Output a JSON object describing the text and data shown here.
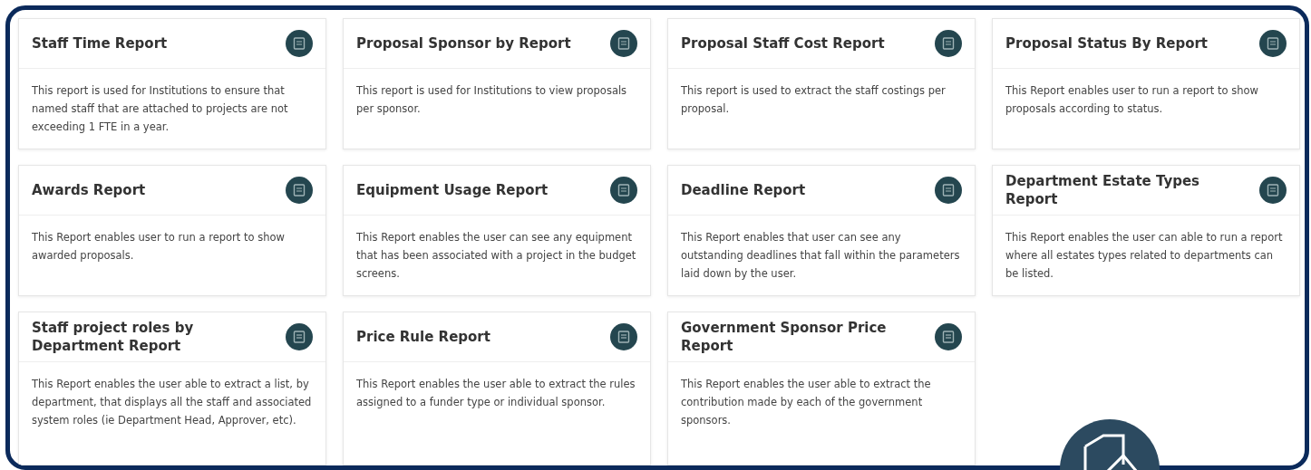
{
  "reports": [
    {
      "title": "Staff Time Report",
      "description": "This report is used for Institutions to ensure that named staff that are attached to projects are not exceeding 1 FTE in a year."
    },
    {
      "title": "Proposal Sponsor by Report",
      "description": "This report is used for Institutions to view proposals per sponsor."
    },
    {
      "title": "Proposal Staff Cost Report",
      "description": "This report is used to extract the staff costings per proposal."
    },
    {
      "title": "Proposal Status By Report",
      "description": "This Report enables user to run a report to show proposals according to status."
    },
    {
      "title": "Awards Report",
      "description": "This Report enables user to run a report to show awarded proposals."
    },
    {
      "title": "Equipment Usage Report",
      "description": "This Report enables the user can see any equipment that has been associated with a project in the budget screens."
    },
    {
      "title": "Deadline Report",
      "description": "This Report enables that user can see any outstanding deadlines that fall within the parameters laid down by the user."
    },
    {
      "title": "Department Estate Types Report",
      "description": "This Report enables the user can able to run a report where all estates types related to departments can be listed."
    },
    {
      "title": "Staff project roles by Department Report",
      "description": "This Report enables the user able to extract a list, by department, that displays all the staff and associated system roles (ie Department Head, Approver, etc)."
    },
    {
      "title": "Price Rule Report",
      "description": "This Report enables the user able to extract the rules assigned to a funder type or individual sponsor."
    },
    {
      "title": "Government Sponsor Price Report",
      "description": "This Report enables the user able to extract the contribution made by each of the government sponsors."
    }
  ]
}
